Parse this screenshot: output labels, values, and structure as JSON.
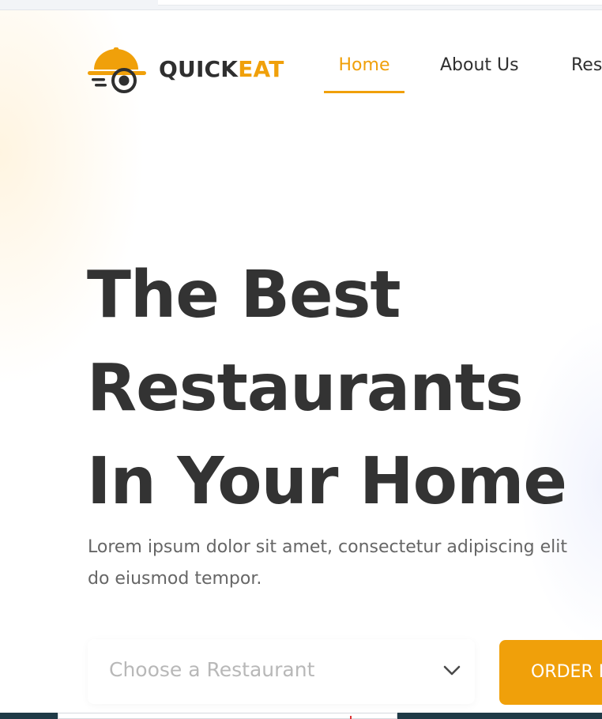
{
  "browser": {
    "top_bar": ""
  },
  "header": {
    "logo_icon": "cloche-icon",
    "brand_part1": "QUICK",
    "brand_part2": "EAT",
    "nav": [
      {
        "label": "Home",
        "active": true
      },
      {
        "label": "About Us",
        "active": false
      },
      {
        "label": "Res",
        "active": false
      }
    ]
  },
  "hero": {
    "headline_lines": [
      "The Best",
      "Restaurants",
      "In Your Home"
    ],
    "subtext_lines": [
      "Lorem ipsum dolor sit amet, consectetur adipiscing elit",
      "do eiusmod tempor."
    ],
    "select_placeholder": "Choose a Restaurant",
    "select_icon": "chevron-down-icon",
    "order_button_label": "ORDER N"
  },
  "colors": {
    "accent": "#f0a00a",
    "text_dark": "#333333",
    "text_muted": "#666666",
    "placeholder": "#b8b8b8",
    "footer": "#1f3a46"
  }
}
